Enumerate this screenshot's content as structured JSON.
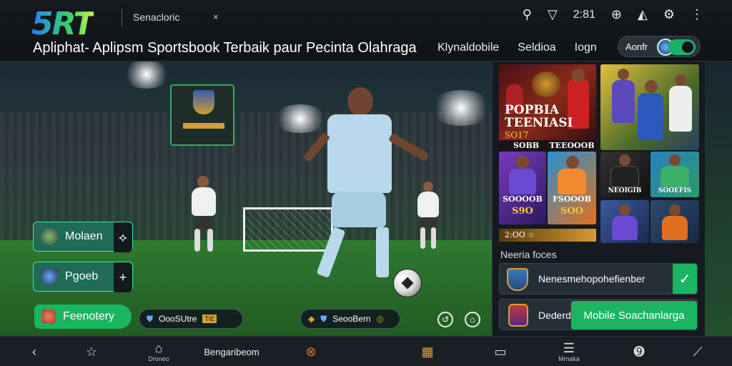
{
  "header": {
    "logo": "5RT",
    "tab_title": "Senacloric",
    "tab_close": "×",
    "clock": "2:81",
    "headline": "Apliphat- Aplipsm Sportsbook Terbaik paur Pecinta Olahraga",
    "nav": [
      "Klynaldobile",
      "Seldioa",
      "Iogn"
    ],
    "login_label": "Aonfr"
  },
  "icons": {
    "search": "search-icon",
    "filter": "filter-icon",
    "help": "help-icon",
    "promo": "promo-icon",
    "settings": "gear-icon",
    "more": "more-vert-icon"
  },
  "hero": {
    "btn1": "Molaen",
    "btn2": "Pgoeb",
    "btn3": "Feenotery",
    "chip1": "OooSUtre",
    "chip1_badge": "TIE",
    "chip2": "SeooBern"
  },
  "panel": {
    "promo_title": "POPBIA TEENIASI",
    "promo_year": "SO17",
    "card_labels": [
      "SOBB",
      "TEEOOOB",
      "SOOOOB",
      "FSOOOB",
      "S9O",
      "SOO",
      "NEOIGIB",
      "SOOEFIS"
    ],
    "strip": "2:OO ☆",
    "news_label": "Neeria foces",
    "row1_text": "Nenesmehopohefienber",
    "row2_text": "Dederd",
    "row2_button": "Mobile Soachanlarga"
  },
  "bottom": {
    "tab1": "Droneo",
    "center_text": "Bengaribeom",
    "tab2": "Mmaka"
  },
  "colors": {
    "accent": "#1bb561",
    "gold": "#d6a030",
    "panel_bg": "#141a20"
  }
}
